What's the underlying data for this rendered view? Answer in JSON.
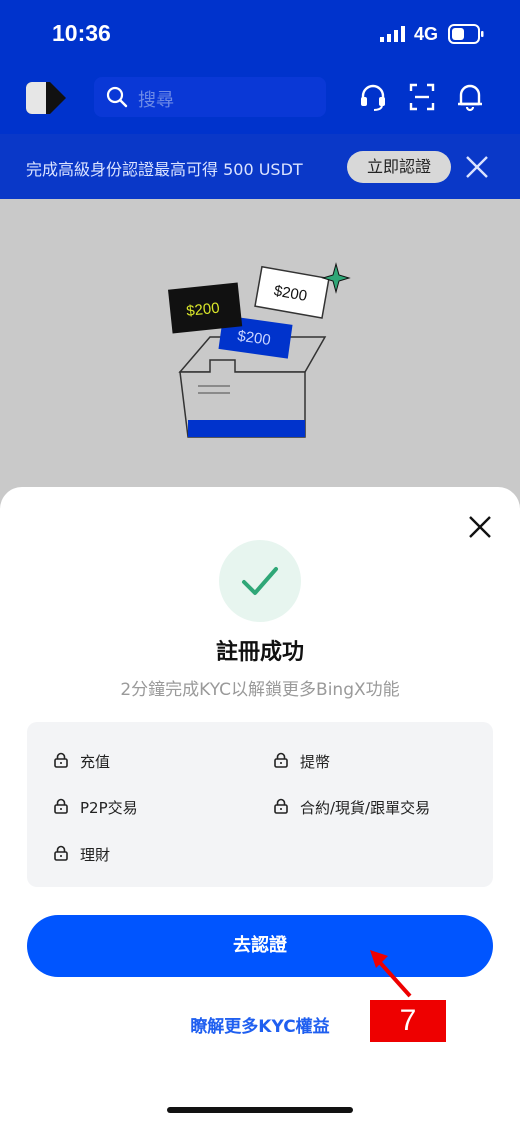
{
  "status_bar": {
    "time": "10:36",
    "network": "4G"
  },
  "header": {
    "search_placeholder": "搜尋"
  },
  "banner": {
    "text": "完成高級身份認證最高可得 500 USDT",
    "button": "立即認證"
  },
  "illustration": {
    "card1": "$200",
    "card2": "$200",
    "card3": "$200"
  },
  "sheet": {
    "title": "註冊成功",
    "subtitle": "2分鐘完成KYC以解鎖更多BingX功能",
    "features": [
      "充值",
      "提幣",
      "P2P交易",
      "合約/現貨/跟單交易",
      "理財"
    ],
    "cta": "去認證",
    "learn_more": "瞭解更多KYC權益"
  },
  "annotation": {
    "badge": "7"
  },
  "colors": {
    "brand_blue": "#0033cc",
    "button_blue": "#0055ff",
    "success_green": "#2fa777",
    "annotation_red": "#ee0000"
  }
}
